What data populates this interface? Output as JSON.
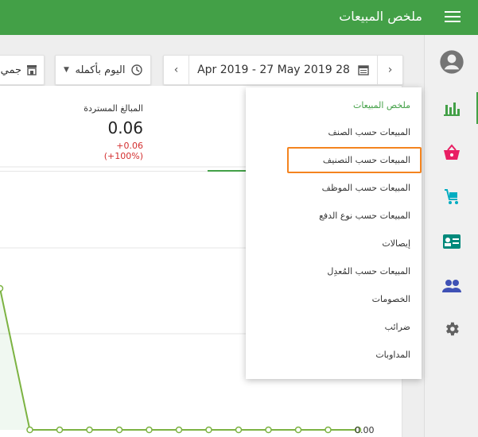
{
  "header": {
    "title": "ملخص المبيعات",
    "menu_icon": "hamburger-menu-icon",
    "background_color": "#43a047"
  },
  "sidebar": {
    "items": [
      {
        "name": "account",
        "icon": "account-circle-icon",
        "color": "#757575",
        "active": false
      },
      {
        "name": "reports",
        "icon": "bar-chart-icon",
        "color": "#43a047",
        "active": true
      },
      {
        "name": "sales",
        "icon": "shopping-basket-icon",
        "color": "#e91e63",
        "active": false
      },
      {
        "name": "items",
        "icon": "cart-icon",
        "color": "#00acc1",
        "active": false
      },
      {
        "name": "customers",
        "icon": "contact-card-icon",
        "color": "#00897b",
        "active": false
      },
      {
        "name": "employees",
        "icon": "group-icon",
        "color": "#3f51b5",
        "active": false
      },
      {
        "name": "settings",
        "icon": "gear-icon",
        "color": "#616161",
        "active": false
      }
    ]
  },
  "toolbar": {
    "date_range": "Apr 2019 - 27 May 2019 28",
    "time_filter": "اليوم بأكمله",
    "store_filter": "جمي"
  },
  "summary": {
    "refunds_label": "المبالغ المستردة",
    "refunds_value": "0.06",
    "refunds_change": "+0.06 (+100%)"
  },
  "chart_data": {
    "type": "line",
    "y_tick_labels": [
      "0.00"
    ],
    "series": [
      {
        "values": [
          0.06,
          0,
          0,
          0,
          0,
          0,
          0,
          0,
          0,
          0,
          0,
          0,
          0
        ]
      }
    ]
  },
  "dropdown": {
    "items": [
      {
        "label": "ملخص المبيعات",
        "header": true
      },
      {
        "label": "المبيعات حسب الصنف"
      },
      {
        "label": "المبيعات حسب التصنيف",
        "highlighted": true
      },
      {
        "label": "المبيعات حسب الموظف"
      },
      {
        "label": "المبيعات حسب نوع الدفع"
      },
      {
        "label": "إيصالات"
      },
      {
        "label": "المبيعات حسب المُعدِل"
      },
      {
        "label": "الخصومات"
      },
      {
        "label": "ضرائب"
      },
      {
        "label": "المداوبات"
      }
    ]
  }
}
